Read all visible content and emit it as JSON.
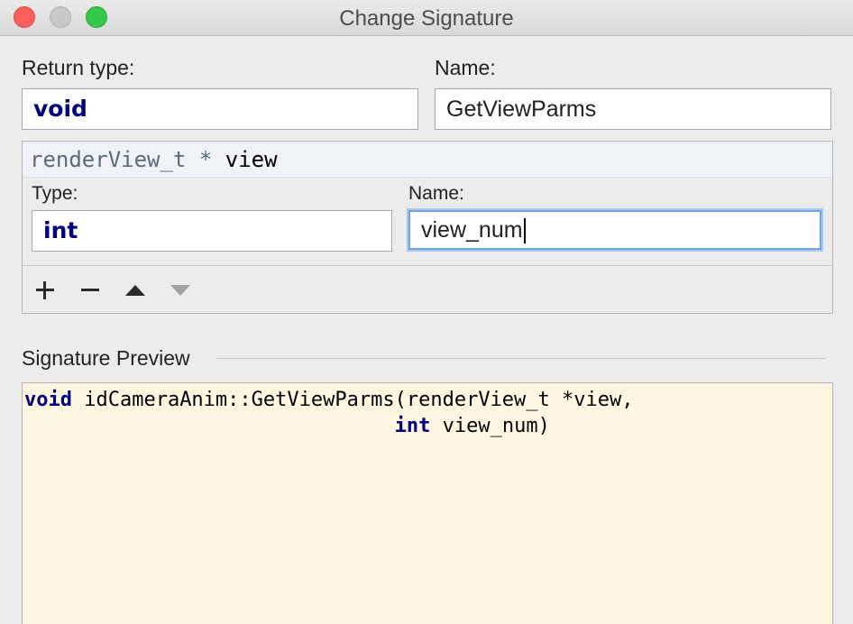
{
  "window": {
    "title": "Change Signature"
  },
  "return_type": {
    "label": "Return type:",
    "value": "void"
  },
  "method_name": {
    "label": "Name:",
    "value": "GetViewParms"
  },
  "parameter": {
    "type_text": "renderView_t *",
    "name_text": "view",
    "type_label": "Type:",
    "type_value": "int",
    "name_label": "Name:",
    "name_value": "view_num"
  },
  "toolbar": {
    "add_icon": "plus-icon",
    "remove_icon": "minus-icon",
    "up_icon": "arrow-up-icon",
    "down_icon": "arrow-down-icon"
  },
  "preview": {
    "label": "Signature Preview",
    "line1_kw": "void",
    "line1_rest": " idCameraAnim::GetViewParms(renderView_t *view,",
    "line2_indent": "                               ",
    "line2_kw": "int",
    "line2_rest": " view_num)"
  },
  "colors": {
    "keyword": "#000080",
    "preview_bg": "#fdf7e2",
    "focus_ring": "#6ea4e6",
    "close": "#fc605c",
    "maximize": "#34c84a"
  }
}
